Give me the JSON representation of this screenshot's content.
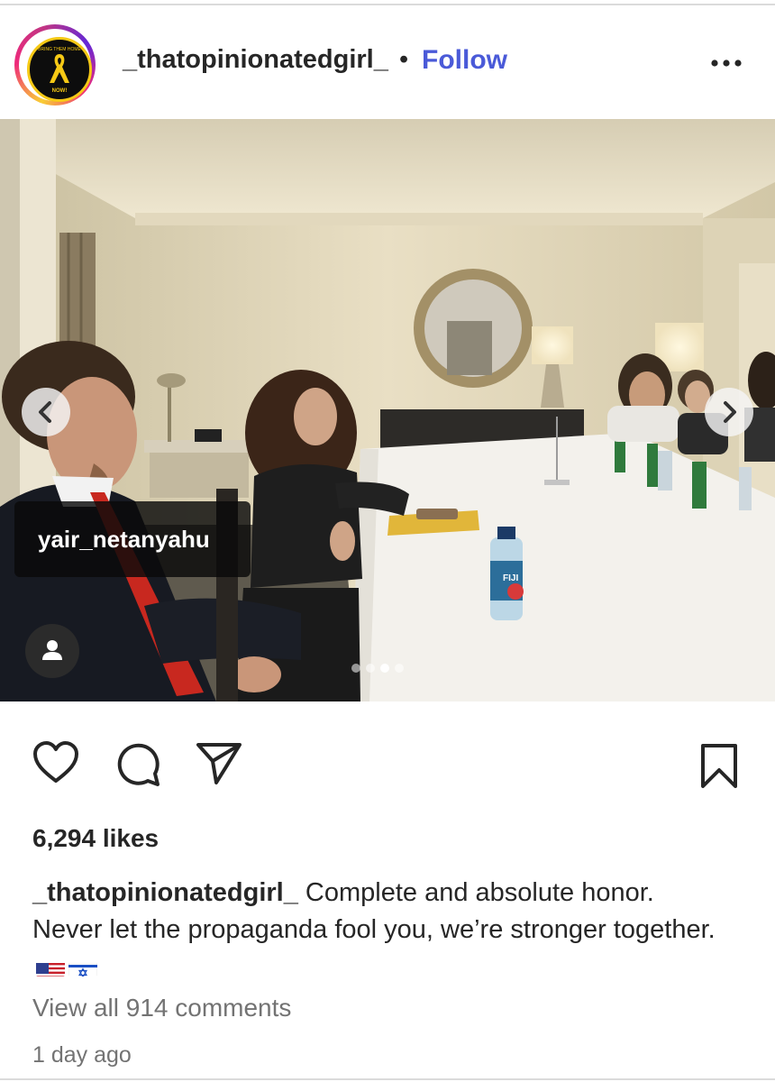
{
  "post": {
    "username": "_thatopinionatedgirl_",
    "separator": "•",
    "follow_label": "Follow",
    "avatar_badge_text": "BRING THEM HOME NOW!",
    "more_icon": "more-horizontal-icon"
  },
  "media": {
    "tagged_user": "yair_netanyahu",
    "carousel_total": 4,
    "carousel_active_index": 2,
    "nav_prev_icon": "chevron-left-icon",
    "nav_next_icon": "chevron-right-icon",
    "user_tag_icon": "person-icon",
    "bottle_label": "FIJI"
  },
  "actions": {
    "like_icon": "heart-icon",
    "comment_icon": "comment-icon",
    "share_icon": "send-icon",
    "save_icon": "bookmark-icon"
  },
  "engagement": {
    "likes_text": "6,294 likes",
    "caption_user": "_thatopinionatedgirl_",
    "caption_text": "Complete and absolute honor. Never let the propaganda fool you, we’re stronger together.",
    "caption_emojis": [
      "us-flag",
      "israel-flag"
    ],
    "view_comments": "View all 914 comments",
    "timestamp": "1 day ago"
  },
  "colors": {
    "follow": "#4a5ad8",
    "text": "#262626",
    "muted": "#737373"
  }
}
